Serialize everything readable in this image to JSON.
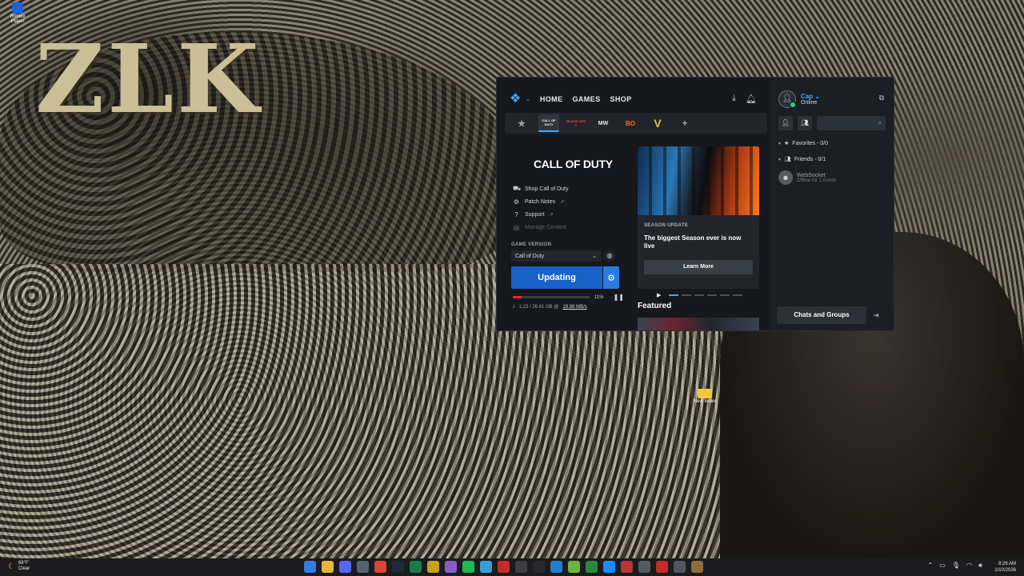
{
  "desktop": {
    "wallpaper_text": "ZLK",
    "icons": [
      {
        "label": "Roblox Player"
      }
    ],
    "new_folder_label": "New folder"
  },
  "app": {
    "window_controls": [
      "—",
      "☐",
      "✕"
    ],
    "nav": {
      "home": "HOME",
      "games": "GAMES",
      "shop": "SHOP"
    },
    "game_tabs": [
      {
        "label": "CALL OF DUTY",
        "active": true
      },
      {
        "label": "BLACK OPS 6"
      },
      {
        "label": "MW"
      },
      {
        "label": "BO"
      },
      {
        "label": "V"
      }
    ],
    "game": {
      "logo": "CALL OF DUTY",
      "links": [
        {
          "label": "Shop Call of Duty",
          "icon": "cart-icon",
          "external": false
        },
        {
          "label": "Patch Notes",
          "icon": "gear-icon",
          "external": true
        },
        {
          "label": "Support",
          "icon": "help-icon",
          "external": true
        },
        {
          "label": "Manage Content",
          "icon": "box-icon",
          "disabled": true
        }
      ],
      "game_version_label": "GAME VERSION",
      "game_version_value": "Call of Duty",
      "update_button": "Updating",
      "progress_percent": 11,
      "progress_label": "11%",
      "download_status": "1.23 / 26.61 GB @",
      "download_speed": "19.88 MB/s"
    },
    "card": {
      "label": "SEASON UPDATE",
      "title": "The biggest Season ever is now live",
      "button": "Learn More",
      "slides": 6,
      "active_slide": 1
    },
    "featured_label": "Featured",
    "social": {
      "username": "Cap",
      "status": "Online",
      "search_placeholder": "",
      "favorites": "Favorites - 0/0",
      "friends": "Friends - 0/1",
      "friend_list": [
        {
          "name": "WebSocket",
          "status": "Offline for 1 month"
        }
      ],
      "chats_button": "Chats and Groups"
    }
  },
  "taskbar": {
    "weather_temp": "68°F",
    "weather_cond": "Clear",
    "time": "8:26 AM",
    "date": "1/10/2026",
    "apps": [
      {
        "icon": "windows-icon",
        "color": "#2f7de1"
      },
      {
        "icon": "file-explorer-icon",
        "color": "#e4b63a"
      },
      {
        "icon": "discord-icon",
        "color": "#5865f2"
      },
      {
        "icon": "settings-icon",
        "color": "#5a6270"
      },
      {
        "icon": "chrome-icon",
        "color": "#d9452f"
      },
      {
        "icon": "steam-icon",
        "color": "#1b2a3c"
      },
      {
        "icon": "terminal-icon",
        "color": "#1d7a4a"
      },
      {
        "icon": "photoshop-icon",
        "color": "#c9a21a"
      },
      {
        "icon": "photos-icon",
        "color": "#8a5cc9"
      },
      {
        "icon": "spotify-icon",
        "color": "#1db954"
      },
      {
        "icon": "app-icon",
        "color": "#3b9bd8"
      },
      {
        "icon": "app2-icon",
        "color": "#c42b2b"
      },
      {
        "icon": "app3-icon",
        "color": "#3d3d44"
      },
      {
        "icon": "epic-icon",
        "color": "#2a2a2e"
      },
      {
        "icon": "vs-code-icon",
        "color": "#1e7fcf"
      },
      {
        "icon": "nvidia-icon",
        "color": "#6cb33f"
      },
      {
        "icon": "xbox-icon",
        "color": "#2a8a3c"
      },
      {
        "icon": "battlenet-icon",
        "color": "#148eff"
      },
      {
        "icon": "app4-icon",
        "color": "#b23838"
      },
      {
        "icon": "app5-icon",
        "color": "#555b66"
      },
      {
        "icon": "app6-icon",
        "color": "#c42b2b"
      },
      {
        "icon": "app7-icon",
        "color": "#4e5563"
      },
      {
        "icon": "app8-icon",
        "color": "#8a6d3b"
      }
    ]
  }
}
